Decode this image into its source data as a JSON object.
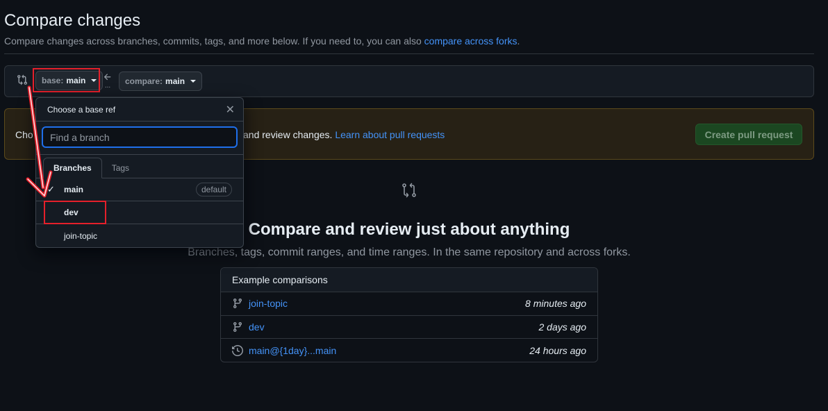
{
  "header": {
    "title": "Compare changes",
    "subtitle": "Compare changes across branches, commits, tags, and more below. If you need to, you can also",
    "subtitle_link": "compare across forks",
    "subtitle_end": "."
  },
  "range": {
    "base_label": "base:",
    "base_value": "main",
    "compare_label": "compare:",
    "compare_value": "main"
  },
  "banner": {
    "text_start": "Cho",
    "text_mid": "and review changes.",
    "link": "Learn about pull requests",
    "create_button": "Create pull request"
  },
  "blankslate": {
    "title": "Compare and review just about anything",
    "subtitle": "Branches, tags, commit ranges, and time ranges. In the same repository and across forks."
  },
  "examples": {
    "header": "Example comparisons",
    "rows": [
      {
        "icon": "branch-icon",
        "name": "join-topic",
        "time": "8 minutes ago"
      },
      {
        "icon": "branch-icon",
        "name": "dev",
        "time": "2 days ago"
      },
      {
        "icon": "history-icon",
        "name": "main@{1day}...main",
        "time": "24 hours ago"
      }
    ]
  },
  "dropdown": {
    "title": "Choose a base ref",
    "filter_placeholder": "Find a branch",
    "tabs": [
      "Branches",
      "Tags"
    ],
    "items": [
      {
        "name": "main",
        "selected": true,
        "badge": "default"
      },
      {
        "name": "dev",
        "selected": false,
        "badge": ""
      },
      {
        "name": "join-topic",
        "selected": false,
        "badge": ""
      }
    ]
  },
  "colors": {
    "background": "#0d1117",
    "link": "#4493f8",
    "annotation": "#e5202b",
    "create_button": "#1b4721"
  }
}
